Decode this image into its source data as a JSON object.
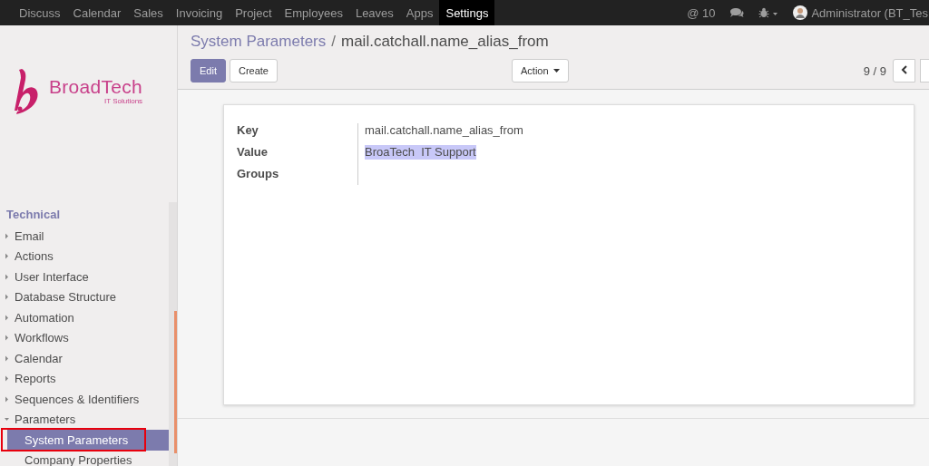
{
  "navbar": {
    "apps": [
      {
        "label": "Discuss",
        "selected": false
      },
      {
        "label": "Calendar",
        "selected": false
      },
      {
        "label": "Sales",
        "selected": false
      },
      {
        "label": "Invoicing",
        "selected": false
      },
      {
        "label": "Project",
        "selected": false
      },
      {
        "label": "Employees",
        "selected": false
      },
      {
        "label": "Leaves",
        "selected": false
      },
      {
        "label": "Apps",
        "selected": false
      },
      {
        "label": "Settings",
        "selected": true
      }
    ],
    "mentions": "@ 10",
    "user": "Administrator (BT_Tes"
  },
  "sidebar": {
    "logo": {
      "name": "BroadTech",
      "tagline": "IT Solutions"
    },
    "section": "Technical",
    "items": [
      {
        "label": "Email",
        "expanded": false
      },
      {
        "label": "Actions",
        "expanded": false
      },
      {
        "label": "User Interface",
        "expanded": false
      },
      {
        "label": "Database Structure",
        "expanded": false
      },
      {
        "label": "Automation",
        "expanded": false
      },
      {
        "label": "Workflows",
        "expanded": false
      },
      {
        "label": "Calendar",
        "expanded": false
      },
      {
        "label": "Reports",
        "expanded": false
      },
      {
        "label": "Sequences & Identifiers",
        "expanded": false
      },
      {
        "label": "Parameters",
        "expanded": true,
        "children": [
          {
            "label": "System Parameters",
            "selected": true
          },
          {
            "label": "Company Properties",
            "selected": false
          }
        ]
      }
    ]
  },
  "breadcrumb_separator": "/",
  "breadcrumb": [
    {
      "label": "System Parameters",
      "kind": "link"
    },
    {
      "label": "mail.catchall.name_alias_from",
      "kind": "current"
    }
  ],
  "buttons": [
    {
      "label": "Edit",
      "kind": "primary"
    },
    {
      "label": "Create",
      "kind": "default"
    }
  ],
  "action_menu": "Action",
  "pager": "9 / 9",
  "form": {
    "fields": [
      {
        "label": "Key",
        "value": "mail.catchall.name_alias_from",
        "highlighted": false
      },
      {
        "label": "Value",
        "value": "BroaTech  IT Support",
        "highlighted": true
      },
      {
        "label": "Groups"
      }
    ]
  }
}
